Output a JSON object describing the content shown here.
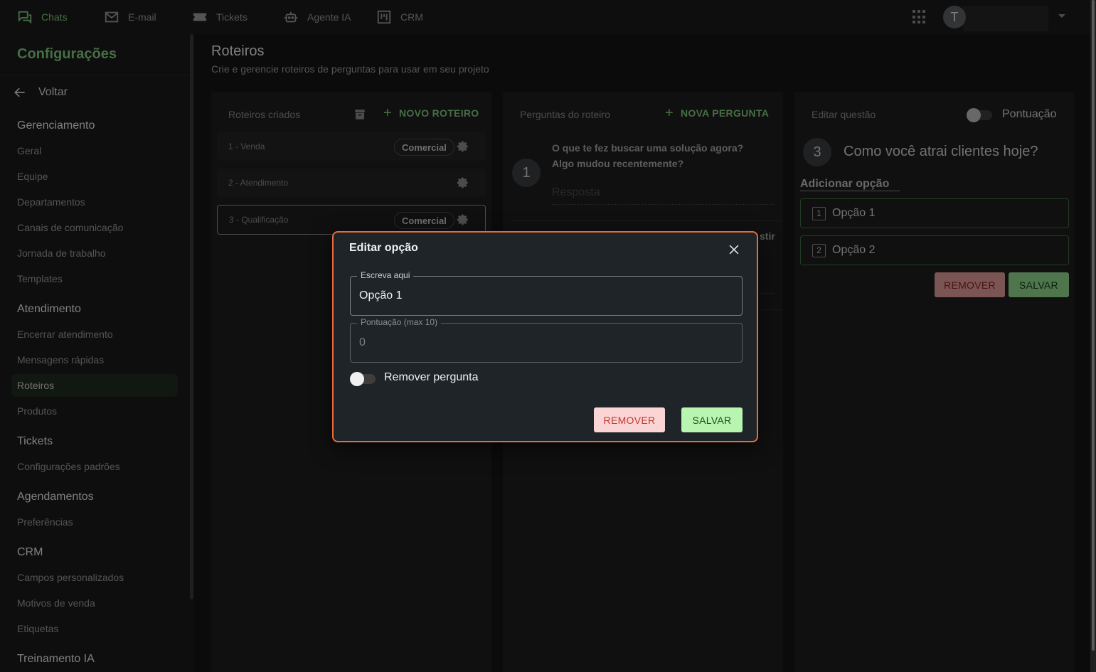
{
  "topnav": {
    "items": [
      {
        "label": "Chats",
        "icon": "chat-icon"
      },
      {
        "label": "E-mail",
        "icon": "mail-icon"
      },
      {
        "label": "Tickets",
        "icon": "ticket-icon"
      },
      {
        "label": "Agente IA",
        "icon": "robot-icon"
      },
      {
        "label": "CRM",
        "icon": "kanban-icon"
      }
    ],
    "avatar_initial": "T"
  },
  "sidebar": {
    "title": "Configurações",
    "back_label": "Voltar",
    "sections": [
      {
        "title": "Gerenciamento",
        "items": [
          "Geral",
          "Equipe",
          "Departamentos",
          "Canais de comunicação",
          "Jornada de trabalho",
          "Templates"
        ]
      },
      {
        "title": "Atendimento",
        "items": [
          "Encerrar atendimento",
          "Mensagens rápidas",
          "Roteiros",
          "Produtos"
        ]
      },
      {
        "title": "Tickets",
        "items": [
          "Configurações padrões"
        ]
      },
      {
        "title": "Agendamentos",
        "items": [
          "Preferências"
        ]
      },
      {
        "title": "CRM",
        "items": [
          "Campos personalizados",
          "Motivos de venda",
          "Etiquetas"
        ]
      },
      {
        "title": "Treinamento IA",
        "items": []
      }
    ],
    "active_item": "Roteiros"
  },
  "page": {
    "title": "Roteiros",
    "subtitle": "Crie e gerencie roteiros de perguntas para usar em seu projeto"
  },
  "scripts_panel": {
    "header": "Roteiros criados",
    "new_label": "NOVO ROTEIRO",
    "scripts": [
      {
        "label": "1 - Venda",
        "tag": "Comercial"
      },
      {
        "label": "2 - Atendimento",
        "tag": ""
      },
      {
        "label": "3 - Qualificação",
        "tag": "Comercial"
      }
    ]
  },
  "questions_panel": {
    "header": "Perguntas do roteiro",
    "new_label": "NOVA PERGUNTA",
    "questions": [
      {
        "number": "1",
        "text": "O que te fez buscar uma solução agora? Algo mudou recentemente?",
        "answer_placeholder": "Resposta"
      }
    ],
    "peek_text": "stir"
  },
  "edit_panel": {
    "header": "Editar questão",
    "score_toggle_label": "Pontuação",
    "question_number": "3",
    "question_text": "Como você atrai clientes hoje?",
    "add_option_label": "Adicionar opção",
    "options": [
      {
        "index": "1",
        "label": "Opção 1"
      },
      {
        "index": "2",
        "label": "Opção 2"
      }
    ],
    "remove_label": "REMOVER",
    "save_label": "SALVAR"
  },
  "dialog": {
    "title": "Editar opção",
    "text_field_label": "Escreva aqui",
    "text_field_value": "Opção 1",
    "score_field_label": "Pontuação (max 10)",
    "score_field_value": "0",
    "remove_toggle_label": "Remover pergunta",
    "remove_label": "REMOVER",
    "save_label": "SALVAR"
  },
  "colors": {
    "accent_green": "#7fc97f",
    "dialog_border": "#ec6a3a",
    "remove_bg": "#fbd5d5",
    "save_bg": "#b8f5b0"
  }
}
